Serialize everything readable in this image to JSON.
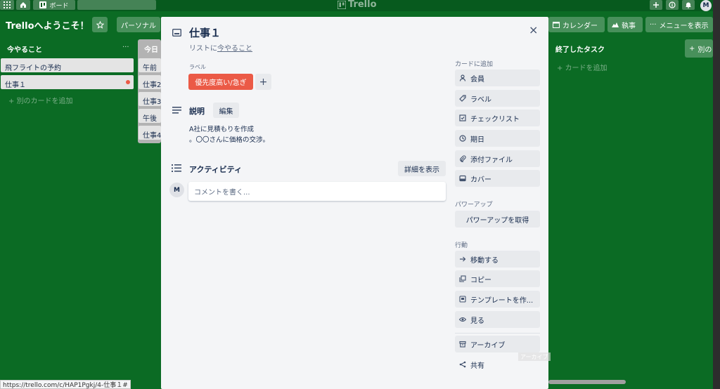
{
  "topbar": {
    "board_btn": "ボード",
    "logo": "Trello",
    "avatar": "M"
  },
  "boardbar": {
    "title": "Trelloへようこそ！",
    "personal": "パーソナル",
    "calendar": "カレンダー",
    "butler": "執事",
    "menu": "メニューを表示"
  },
  "lists": [
    {
      "title": "今やること",
      "cards": [
        "飛フライトの予約",
        "仕事１"
      ],
      "add": "別のカードを追加"
    },
    {
      "title": "今日",
      "cards": [
        "午前",
        "仕事2",
        "仕事3",
        "午後",
        "仕事4"
      ]
    },
    {
      "title": "終了したタスク",
      "add": "カードを追加"
    },
    {
      "add": "別の"
    }
  ],
  "modal": {
    "title": "仕事１",
    "list_prefix": "リストに",
    "list_name": "今やること",
    "labels_heading": "ラベル",
    "label_tag": "優先度高い/急ぎ",
    "label_add": "+",
    "desc_heading": "説明",
    "edit_btn": "編集",
    "desc_line1": "A社に見積もりを作成",
    "desc_line2": "。〇〇さんに価格の交渉。",
    "activity_heading": "アクティビティ",
    "details_btn": "詳細を表示",
    "comment_avatar": "M",
    "comment_placeholder": "コメントを書く...",
    "close": "×"
  },
  "sidebar": {
    "add_heading": "カードに追加",
    "add_items": [
      {
        "label": "会員",
        "icon": "person-icon"
      },
      {
        "label": "ラベル",
        "icon": "tag-icon"
      },
      {
        "label": "チェックリスト",
        "icon": "checkbox-icon"
      },
      {
        "label": "期日",
        "icon": "clock-icon"
      },
      {
        "label": "添付ファイル",
        "icon": "paperclip-icon"
      },
      {
        "label": "カバー",
        "icon": "cover-icon"
      }
    ],
    "powerup_heading": "パワーアップ",
    "powerup_btn": "パワーアップを取得",
    "actions_heading": "行動",
    "action_items": [
      {
        "label": "移動する",
        "icon": "arrow-right-icon"
      },
      {
        "label": "コピー",
        "icon": "copy-icon"
      },
      {
        "label": "テンプレートを作...",
        "icon": "template-icon"
      },
      {
        "label": "見る",
        "icon": "eye-icon"
      }
    ],
    "archive": "アーカイブ",
    "share": "共有"
  },
  "tooltip": "アーカイブ",
  "statusbar": "https://trello.com/c/HAP1Pgkj/4-仕事１#"
}
